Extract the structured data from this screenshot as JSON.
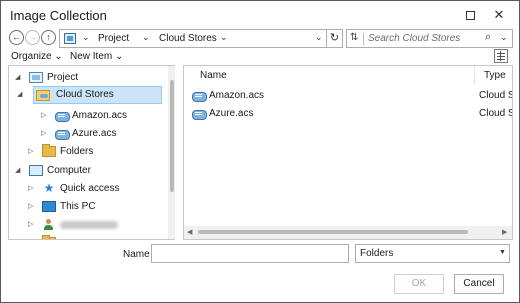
{
  "window": {
    "title": "Image Collection"
  },
  "navbar": {
    "back_glyph": "←",
    "forward_glyph": "→",
    "up_glyph": "↑",
    "refresh_glyph": "↻",
    "breadcrumbs": [
      {
        "label": "Project"
      },
      {
        "label": "Cloud Stores"
      }
    ],
    "search": {
      "placeholder": "Search Cloud Stores",
      "icon": "search-icon"
    }
  },
  "toolbar": {
    "organize_label": "Organize",
    "new_item_label": "New Item"
  },
  "tree": {
    "items": [
      {
        "label": "Project",
        "icon": "project-icon",
        "expanded": true
      },
      {
        "label": "Cloud Stores",
        "icon": "cloud-stores-folder-icon",
        "expanded": true,
        "selected": true
      },
      {
        "label": "Amazon.acs",
        "icon": "cloud-connection-icon",
        "expanded": false
      },
      {
        "label": "Azure.acs",
        "icon": "cloud-connection-icon",
        "expanded": false
      },
      {
        "label": "Folders",
        "icon": "folder-icon",
        "expanded": false
      },
      {
        "label": "Computer",
        "icon": "computer-icon",
        "expanded": true
      },
      {
        "label": "Quick access",
        "icon": "star-icon",
        "expanded": false
      },
      {
        "label": "This PC",
        "icon": "monitor-icon",
        "expanded": false
      },
      {
        "label": "",
        "icon": "user-icon",
        "expanded": false,
        "obscured": true
      }
    ]
  },
  "file_list": {
    "columns": [
      {
        "label": "Name"
      },
      {
        "label": "Type"
      }
    ],
    "rows": [
      {
        "name": "Amazon.acs",
        "type": "Cloud St"
      },
      {
        "name": "Azure.acs",
        "type": "Cloud St"
      }
    ]
  },
  "footer": {
    "name_label": "Name",
    "name_value": "",
    "filter_value": "Folders",
    "ok_label": "OK",
    "cancel_label": "Cancel"
  }
}
